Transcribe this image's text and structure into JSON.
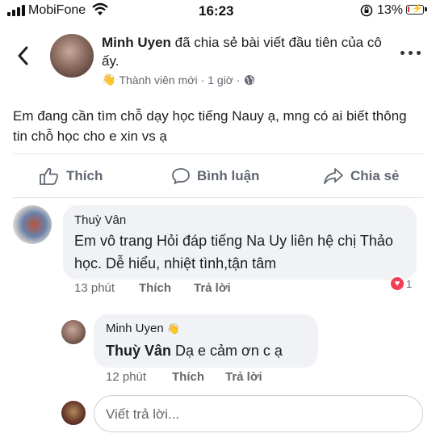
{
  "status_bar": {
    "carrier": "MobiFone",
    "time": "16:23",
    "battery_percent": "13%",
    "battery_level": 0.13,
    "icons": [
      "signal-icon",
      "wifi-icon",
      "orientation-lock-icon",
      "battery-charging-icon"
    ],
    "battery_color": "#e2402c"
  },
  "post": {
    "author": "Minh Uyen",
    "action_text": " đã chia sẻ bài viết đầu tiên của cô ấy.",
    "badge": "Thành viên mới",
    "separator": "·",
    "time": "1 giờ",
    "separator2": "·",
    "text": "Em đang cần tìm chỗ dạy học tiếng Nauy ạ, mng có ai biết thông tin chỗ học cho e xin vs ạ",
    "icons": [
      "back-chevron-icon",
      "more-dots-icon",
      "wave-hand-icon",
      "globe-icon"
    ]
  },
  "actions": {
    "like": "Thích",
    "comment": "Bình luận",
    "share": "Chia sẻ"
  },
  "comments": [
    {
      "author": "Thuỳ Vân",
      "text": "Em vô trang Hỏi đáp tiếng Na Uy liên hệ chị Thảo học. Dễ hiểu, nhiệt tình,tận tâm",
      "time": "13 phút",
      "like": "Thích",
      "reply": "Trả lời",
      "reaction_count": "1"
    }
  ],
  "reply": {
    "author": "Minh Uyen",
    "mention": "Thuỳ Vân",
    "text": " Dạ e cảm ơn c ạ",
    "time": "12 phút",
    "like": "Thích",
    "reply": "Trả lời"
  },
  "composer": {
    "placeholder": "Viết trả lời..."
  },
  "colors": {
    "secondary_text": "#606770",
    "bubble": "#f0f2f5",
    "reaction": "#f33e58"
  }
}
